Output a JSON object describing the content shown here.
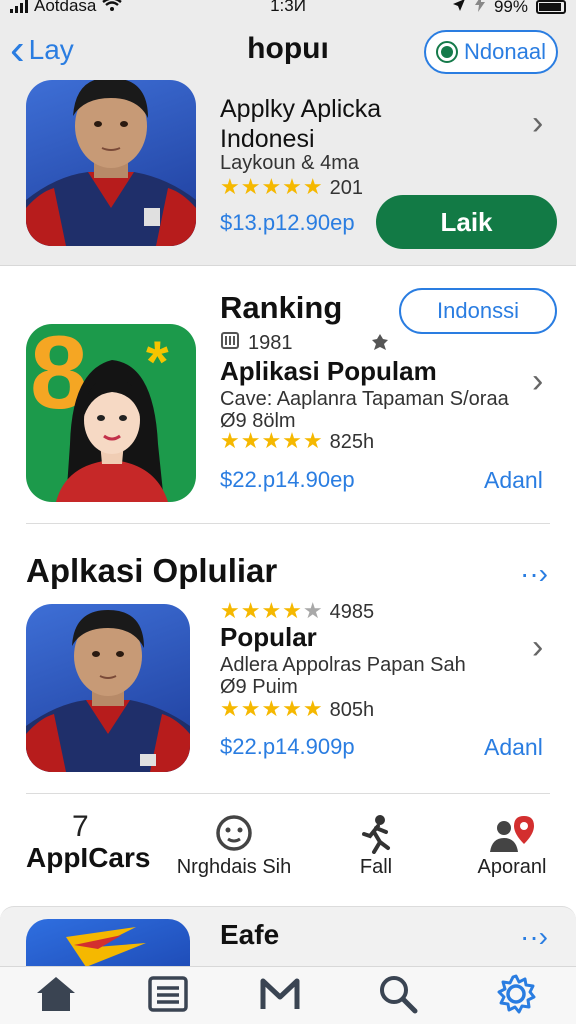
{
  "status": {
    "carrier": "Aotdasa",
    "time": "1:3И",
    "battery": "99%"
  },
  "header": {
    "back_label": "Lay",
    "title": "hopuı",
    "region_label": "Ndonaal"
  },
  "featured": {
    "title": "Applky Aplicka\nIndonesi",
    "subtitle": "Laykoun & 4ma",
    "rating_count": "201",
    "price": "$13.p12.90ep",
    "action_label": "Laik"
  },
  "ranking": {
    "heading": "Ranking",
    "region_button": "Indonssi",
    "rank": "1981",
    "app_title": "Aplikasi Populam",
    "description": "Cave: Aaplanra Tapaman S/oraa",
    "size": "Ø9 8ölm",
    "rating_count": "825h",
    "price": "$22.p14.90ep",
    "action_label": "Adanl"
  },
  "popular": {
    "heading": "Aplkasi Opluliar",
    "rating_top": "4985",
    "app_title": "Popular",
    "description": "Adlera Appolras Papan Sah",
    "size": "Ø9 Puim",
    "rating_count": "805h",
    "price": "$22.p14.909p",
    "action_label": "Adanl"
  },
  "categories": [
    {
      "label": "AppICars",
      "icon": "seven-icon",
      "top": "7"
    },
    {
      "label": "Nrghdais Sih",
      "icon": "face-icon"
    },
    {
      "label": "Fall",
      "icon": "runner-icon"
    },
    {
      "label": "Aporanl",
      "icon": "person-pin-icon"
    }
  ],
  "bottom_card": {
    "title": "Eafe"
  },
  "tabbar": {
    "tabs": [
      "home-icon",
      "list-icon",
      "m-icon",
      "search-icon",
      "gear-icon"
    ]
  },
  "colors": {
    "accent": "#2a7de1",
    "button_green": "#127a45",
    "star": "#f5b800"
  }
}
